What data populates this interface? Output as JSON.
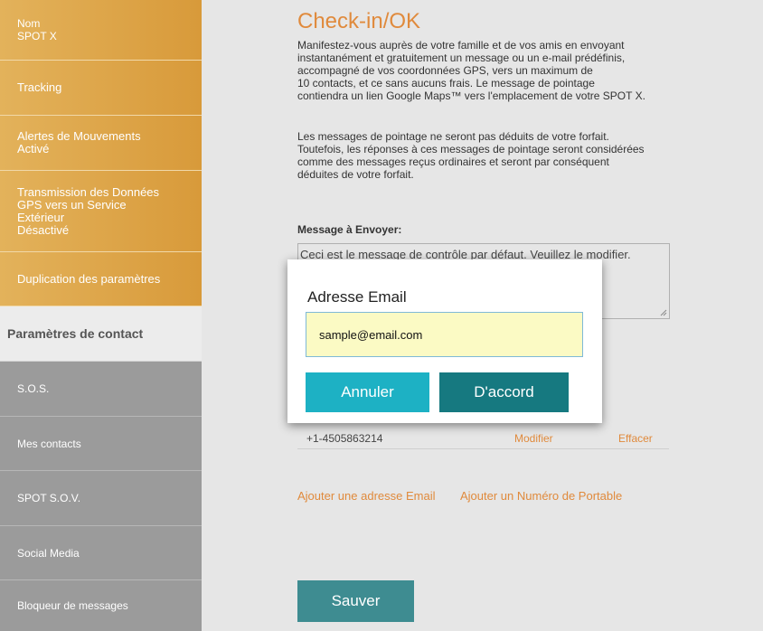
{
  "sidebar": {
    "items": [
      {
        "lines": [
          "Nom",
          "SPOT X"
        ]
      },
      {
        "lines": [
          "Tracking"
        ]
      },
      {
        "lines": [
          "Alertes de Mouvements",
          "Activé"
        ]
      },
      {
        "lines": [
          "Transmission des Données",
          "GPS vers un Service",
          "Extérieur",
          "Désactivé"
        ]
      },
      {
        "lines": [
          "Duplication des paramètres"
        ]
      },
      {
        "lines": [
          "Paramètres de contact"
        ]
      },
      {
        "lines": [
          "S.O.S."
        ]
      },
      {
        "lines": [
          "Mes contacts"
        ]
      },
      {
        "lines": [
          "SPOT S.O.V."
        ]
      },
      {
        "lines": [
          "Social Media"
        ]
      },
      {
        "lines": [
          "Bloqueur de messages"
        ]
      }
    ]
  },
  "main": {
    "title": "Check-in/OK",
    "paragraph1": "Manifestez-vous auprès de votre famille et de vos amis en envoyant\ninstantanément et gratuitement un message ou un e-mail prédéfinis,\naccompagné de vos coordonnées GPS, vers un maximum de\n10 contacts, et ce sans aucuns frais. Le message de pointage\ncontiendra un lien Google Maps™ vers l'emplacement de votre SPOT X.",
    "paragraph2": "Les messages de pointage ne seront pas déduits de votre forfait.\nToutefois, les réponses à ces messages de pointage seront considérées\ncomme des messages reçus ordinaires et seront par conséquent\ndéduites de votre forfait.",
    "message_label": "Message à Envoyer:",
    "message_value": "Ceci est le message de contrôle par défaut. Veuillez le modifier.",
    "contact": {
      "number": "+1-4505863214",
      "modify": "Modifier",
      "delete": "Effacer"
    },
    "add_email": "Ajouter une adresse Email",
    "add_phone": "Ajouter un Numéro de Portable",
    "save": "Sauver"
  },
  "dialog": {
    "title": "Adresse Email",
    "input_value": "sample@email.com",
    "cancel": "Annuler",
    "ok": "D'accord"
  },
  "colors": {
    "accent_orange": "#e08a3c",
    "sidebar_orange": "#dda24a",
    "sidebar_gray": "#9b9b9b",
    "teal_dark": "#167980",
    "teal_light": "#1db1c4",
    "input_bg": "#fbfac4"
  }
}
